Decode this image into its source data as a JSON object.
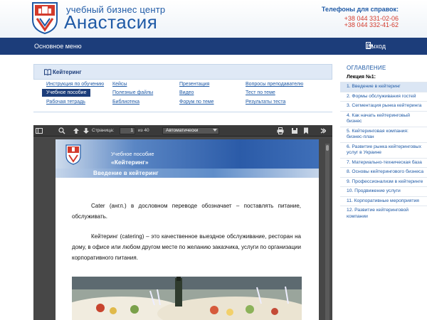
{
  "brand": {
    "subtitle": "учебный бизнес центр",
    "name": "Анастасия"
  },
  "contacts": {
    "title": "Телефоны для справок:",
    "phones": [
      "+38 044 331-02-06",
      "+38 044 332-41-62"
    ]
  },
  "navbar": {
    "menu_label": "Основное меню",
    "exit_label": "Выход"
  },
  "module": {
    "title": "Кейтеринг",
    "links": [
      {
        "label": "Инструкция по обучению"
      },
      {
        "label": "Кейсы"
      },
      {
        "label": "Презентация"
      },
      {
        "label": "Вопросы преподавателю"
      },
      {
        "label": "Учебное пособие",
        "active": true
      },
      {
        "label": "Полезные файлы"
      },
      {
        "label": "Видео"
      },
      {
        "label": "Тест по теме"
      },
      {
        "label": "Рабочая тетрадь"
      },
      {
        "label": "Библиотека"
      },
      {
        "label": "Форум по теме"
      },
      {
        "label": "Результаты теста"
      }
    ]
  },
  "viewer": {
    "page_label": "Страница:",
    "page_current": "1",
    "page_total": "из 40",
    "zoom": "Автоматически"
  },
  "document": {
    "subtitle": "Учебное пособие",
    "course": "«Кейтеринг»",
    "section": "Введение в кейтеринг",
    "paragraphs": [
      "Cater (англ.) в дословном переводе обозначает – поставлять питание, обслуживать.",
      "Кейтеринг (catering) – это качественное выездное обслуживание, ресторан на дому, в офисе или любом другом месте по желанию заказчика, услуги по организации корпоративного питания."
    ]
  },
  "toc": {
    "title": "ОГЛАВЛЕНИЕ",
    "lecture": "Лекция №1:",
    "items": [
      {
        "label": "1. Введение в кейтеринг",
        "active": true
      },
      {
        "label": "2. Формы обслуживания гостей"
      },
      {
        "label": "3. Сегментация рынка кейтеринга"
      },
      {
        "label": "4. Как начать кейтеринговый бизнес"
      },
      {
        "label": "5. Кейтеринговая компания: бизнес-план"
      },
      {
        "label": "6. Развитие рынка кейтеринговых услуг в Украине"
      },
      {
        "label": "7. Материально-техническая база"
      },
      {
        "label": "8. Основы кейтерингового бизнеса"
      },
      {
        "label": "9. Профессионализм в кейтеринге"
      },
      {
        "label": "10. Продвижение услуги"
      },
      {
        "label": "11. Корпоративные мероприятия"
      },
      {
        "label": "12. Развитие кейтеринговой компании"
      }
    ]
  },
  "colors": {
    "brand_blue": "#1f5aa6",
    "nav_dark": "#1c3d7a",
    "phone_red": "#d33a2c"
  }
}
